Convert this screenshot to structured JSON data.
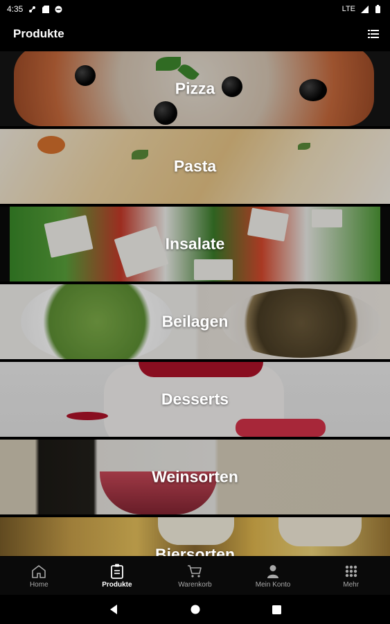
{
  "status_bar": {
    "time": "4:35",
    "network": "LTE"
  },
  "app_bar": {
    "title": "Produkte",
    "menu_icon": "list-view-icon"
  },
  "categories": [
    {
      "label": "Pizza"
    },
    {
      "label": "Pasta"
    },
    {
      "label": "Insalate"
    },
    {
      "label": "Beilagen"
    },
    {
      "label": "Desserts"
    },
    {
      "label": "Weinsorten"
    },
    {
      "label": "Biersorten"
    }
  ],
  "bottom_nav": [
    {
      "label": "Home",
      "icon": "home-icon",
      "active": false
    },
    {
      "label": "Produkte",
      "icon": "menu-card-icon",
      "active": true
    },
    {
      "label": "Warenkorb",
      "icon": "cart-icon",
      "active": false
    },
    {
      "label": "Mein Konto",
      "icon": "person-icon",
      "active": false
    },
    {
      "label": "Mehr",
      "icon": "grid-icon",
      "active": false
    }
  ],
  "colors": {
    "background": "#000000",
    "nav_inactive": "#a8a8a8",
    "nav_active": "#ffffff"
  }
}
